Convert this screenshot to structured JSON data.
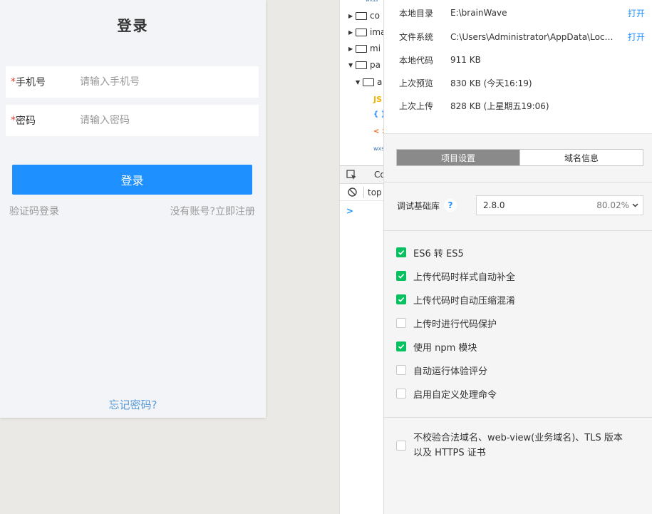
{
  "simulator": {
    "title": "登录",
    "phone_label": "手机号",
    "phone_placeholder": "请输入手机号",
    "password_label": "密码",
    "password_placeholder": "请输入密码",
    "required_mark": "*",
    "login_button": "登录",
    "sms_login_link": "验证码登录",
    "register_link": "没有账号?立即注册",
    "forgot_link": "忘记密码?"
  },
  "devtools": {
    "tree": [
      {
        "type": "folder",
        "label": "co",
        "expanded": false
      },
      {
        "type": "folder",
        "label": "ima",
        "expanded": false
      },
      {
        "type": "folder",
        "label": "mi",
        "expanded": false
      },
      {
        "type": "folder",
        "label": "pa",
        "expanded": true
      },
      {
        "type": "folder",
        "label": "a",
        "expanded": true
      }
    ],
    "file_icons": {
      "js": "JS",
      "json": "{ }",
      "wxml": "< >",
      "wxss": "wxss"
    },
    "console_tab": "Co",
    "context": "top",
    "prompt": ">"
  },
  "details": {
    "rows": [
      {
        "key": "本地目录",
        "value": "E:\\brainWave",
        "action": "打开"
      },
      {
        "key": "文件系统",
        "value": "C:\\Users\\Administrator\\AppData\\Local\\微信开发者工具",
        "action": "打开"
      },
      {
        "key": "本地代码",
        "value": "911 KB",
        "action": ""
      },
      {
        "key": "上次预览",
        "value": "830 KB (今天16:19)",
        "action": ""
      },
      {
        "key": "上次上传",
        "value": "828 KB (上星期五19:06)",
        "action": ""
      }
    ],
    "tabs": [
      {
        "label": "项目设置",
        "active": true
      },
      {
        "label": "域名信息",
        "active": false
      }
    ],
    "base_lib": {
      "label": "调试基础库",
      "help": "?",
      "version": "2.8.0",
      "coverage": "80.02%"
    },
    "options": [
      {
        "label": "ES6 转 ES5",
        "checked": true
      },
      {
        "label": "上传代码时样式自动补全",
        "checked": true
      },
      {
        "label": "上传代码时自动压缩混淆",
        "checked": true
      },
      {
        "label": "上传时进行代码保护",
        "checked": false
      },
      {
        "label": "使用 npm 模块",
        "checked": true
      },
      {
        "label": "自动运行体验评分",
        "checked": false
      },
      {
        "label": "启用自定义处理命令",
        "checked": false
      }
    ],
    "domain_option": {
      "label": "不校验合法域名、web-view(业务域名)、TLS 版本以及 HTTPS 证书",
      "checked": false
    }
  },
  "colors": {
    "primary": "#1e90ff",
    "check_green": "#07c160",
    "required_red": "#e43d33",
    "tab_active": "#8a8a8a"
  }
}
